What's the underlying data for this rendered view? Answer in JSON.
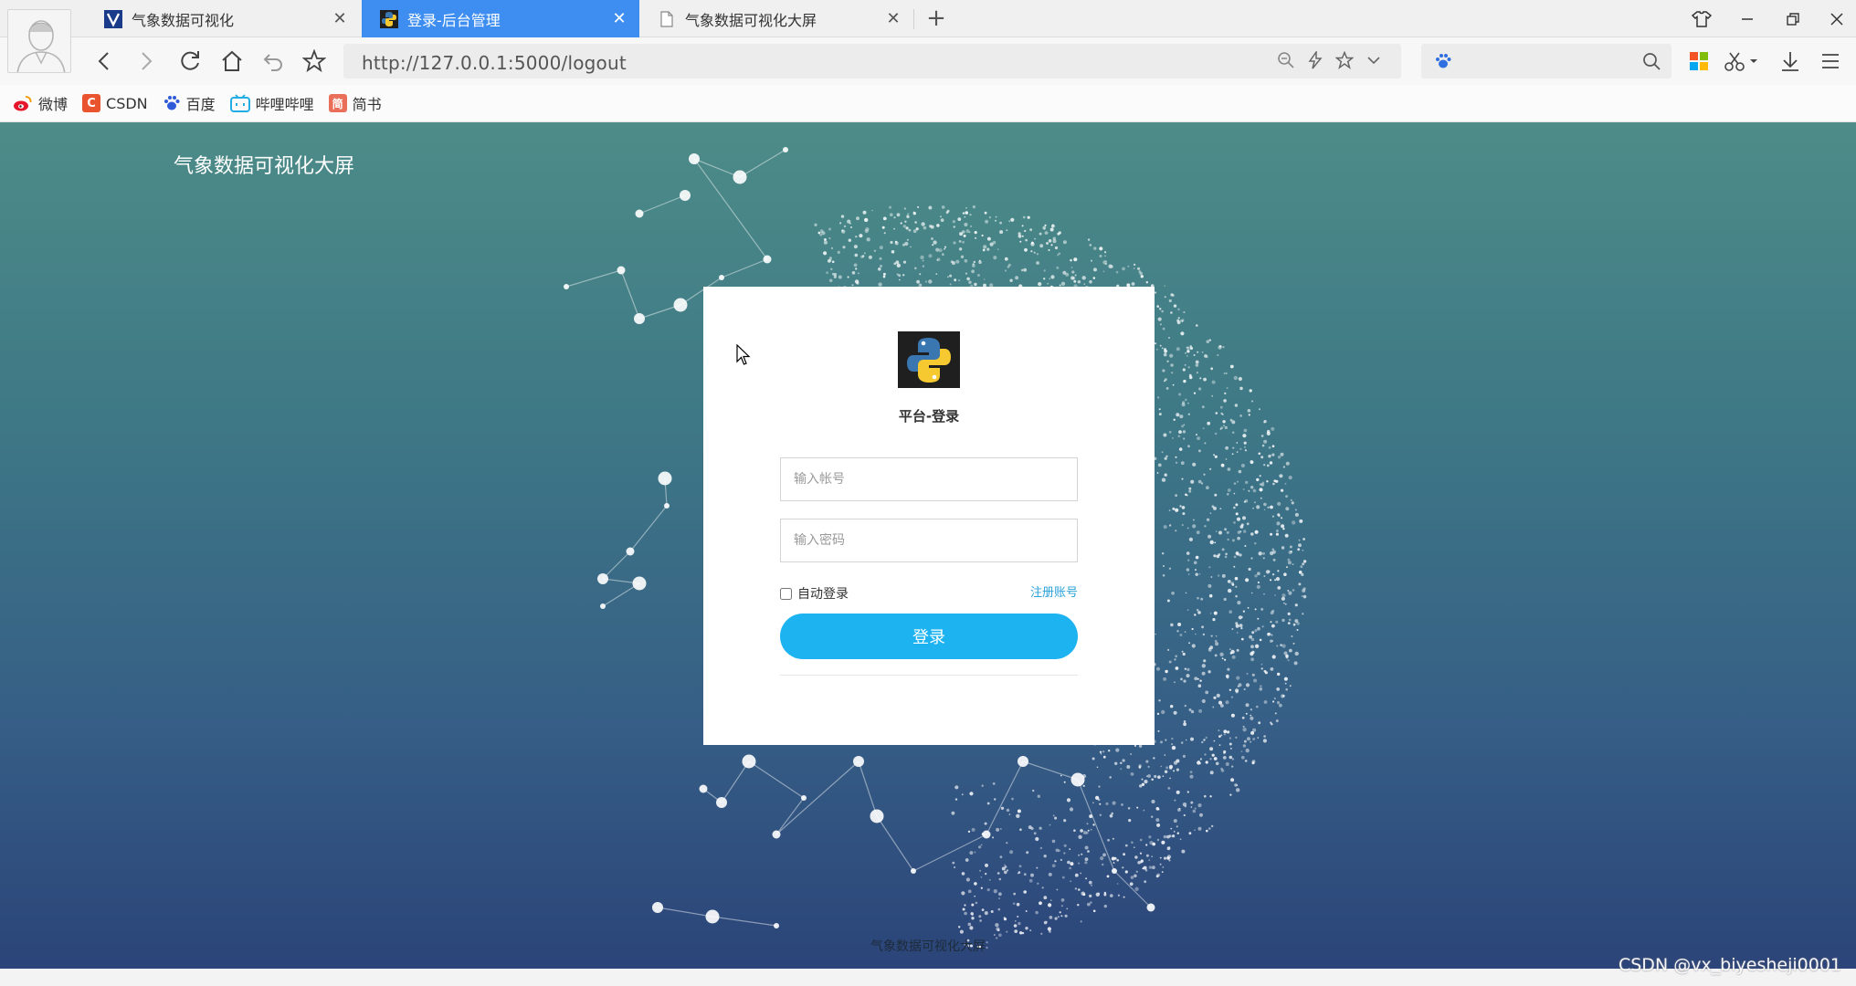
{
  "browser": {
    "tabs": [
      {
        "title": "气象数据可视化",
        "icon": "v-logo-icon",
        "active": false
      },
      {
        "title": "登录-后台管理",
        "icon": "python-logo-icon",
        "active": true
      },
      {
        "title": "气象数据可视化大屏",
        "icon": "document-icon",
        "active": false
      }
    ],
    "url": "http://127.0.0.1:5000/logout",
    "bookmarks": [
      {
        "label": "微博",
        "icon": "weibo-icon"
      },
      {
        "label": "CSDN",
        "icon": "csdn-icon",
        "glyph": "C",
        "color": "#e9532d"
      },
      {
        "label": "百度",
        "icon": "baidu-icon"
      },
      {
        "label": "哔哩哔哩",
        "icon": "bilibili-icon"
      },
      {
        "label": "简书",
        "icon": "jianshu-icon",
        "glyph": "简",
        "color": "#ea6f5a"
      }
    ]
  },
  "page": {
    "site_title": "气象数据可视化大屏",
    "footer": "气象数据可视化大屏",
    "login": {
      "title": "平台-登录",
      "username_placeholder": "输入帐号",
      "password_placeholder": "输入密码",
      "remember_label": "自动登录",
      "register_link": "注册账号",
      "submit_label": "登录"
    }
  },
  "watermark": "CSDN @vx_biyesheji0001",
  "colors": {
    "active_tab": "#3d8ef0",
    "login_button": "#1cb3f0",
    "register_link": "#2aa1d8"
  }
}
